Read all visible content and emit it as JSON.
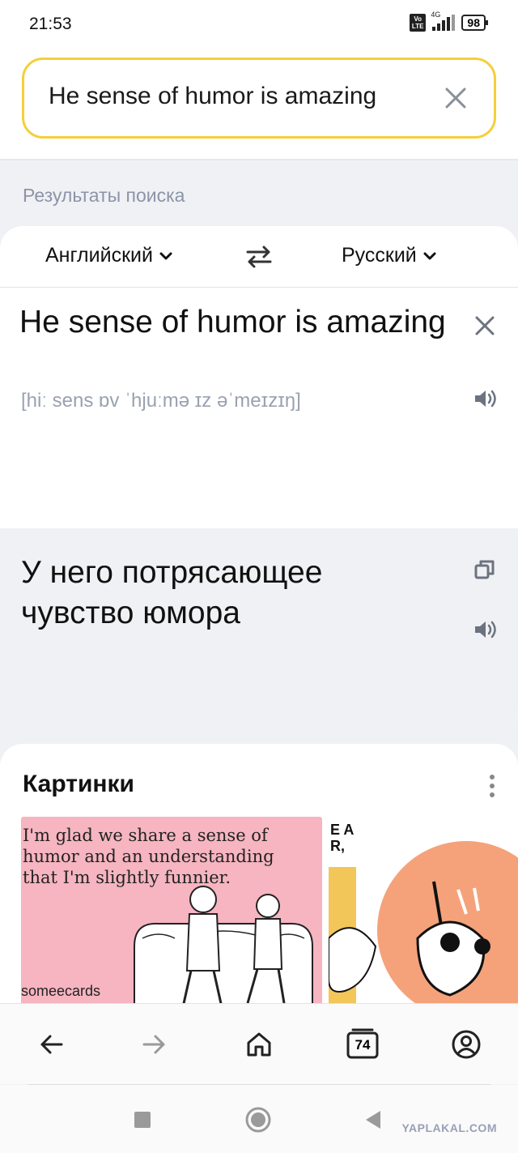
{
  "status_bar": {
    "time": "21:53",
    "volte_label": "Vo LTE",
    "network": "4G",
    "battery": "98"
  },
  "search": {
    "query": "He sense of humor is amazing",
    "accent_color": "#f5cf3a"
  },
  "results_label": "Результаты поиска",
  "translator": {
    "source_lang": "Английский",
    "target_lang": "Русский",
    "source_text": "He sense of humor is amazing",
    "transcription": "[hiː sens ɒv ˈhjuːmə ɪz əˈmeɪzɪŋ]",
    "translation": "У него потрясающее чувство юмора"
  },
  "images": {
    "title": "Картинки",
    "image1_caption": "I'm glad we share a sense of humor and an understanding that I'm slightly funnier.",
    "image1_brand": "someecards",
    "image2_partial": "E A R,"
  },
  "browser_bar": {
    "tab_count": "74",
    "icons": [
      "back-arrow-icon",
      "forward-arrow-icon",
      "home-icon",
      "tabs-icon",
      "profile-icon"
    ]
  },
  "system_nav": {
    "icons": [
      "recents-icon",
      "home-circle-icon",
      "back-triangle-icon"
    ]
  },
  "watermark": "YAPLAKAL.COM"
}
